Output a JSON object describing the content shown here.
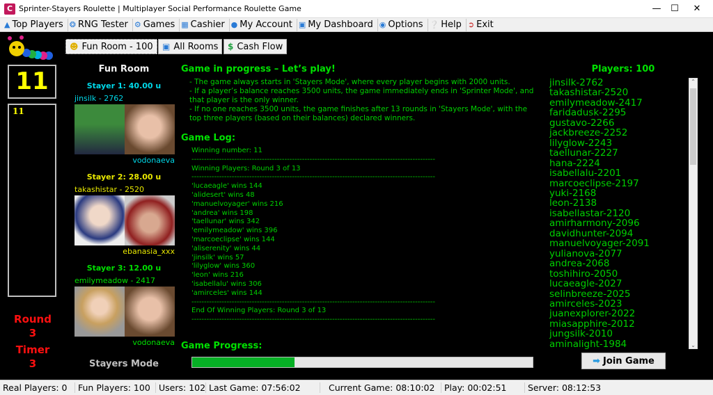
{
  "window": {
    "title": "Sprinter-Stayers Roulette | Multiplayer Social Performance Roulette Game",
    "app_icon": "C"
  },
  "menu": [
    {
      "label": "Top Players",
      "icon": "trophy-icon"
    },
    {
      "label": "RNG Tester",
      "icon": "compass-icon"
    },
    {
      "label": "Games",
      "icon": "gear-icon"
    },
    {
      "label": "Cashier",
      "icon": "calculator-icon"
    },
    {
      "label": "My Account",
      "icon": "user-icon"
    },
    {
      "label": "My Dashboard",
      "icon": "monitor-icon"
    },
    {
      "label": "Options",
      "icon": "options-icon"
    },
    {
      "label": "Help",
      "icon": "help-icon"
    },
    {
      "label": "Exit",
      "icon": "exit-icon"
    }
  ],
  "toolbar": {
    "fun_room": "Fun Room - 100",
    "all_rooms": "All Rooms",
    "cash_flow": "Cash Flow"
  },
  "left": {
    "current_number": "11",
    "history": [
      "11"
    ],
    "round_label": "Round",
    "round": "3",
    "timer_label": "Timer",
    "timer": "3"
  },
  "room": {
    "title": "Fun Room",
    "mode": "Stayers Mode",
    "stayers": [
      {
        "label": "Stayer 1: 40.00 u",
        "player": "jinsilk  -  2762",
        "partner": "vodonaeva",
        "color": "#00d8e8"
      },
      {
        "label": "Stayer 2: 28.00 u",
        "player": "takashistar  -  2520",
        "partner": "ebanasia_xxx",
        "color": "#e8e800"
      },
      {
        "label": "Stayer 3: 12.00 u",
        "player": "emilymeadow  -  2417",
        "partner": "vodonaeva",
        "color": "#00e000"
      }
    ]
  },
  "game": {
    "title": "Game in progress – Let’s play!",
    "rules": [
      "- The game always starts in 'Stayers Mode', where every player begins with 2000 units.",
      "- If a player’s balance reaches 3500 units, the game immediately ends in 'Sprinter Mode', and that player is the only winner.",
      "- If no one reaches 3500 units, the game finishes after 13 rounds in 'Stayers Mode', with the top three players (based on their balances) declared winners."
    ],
    "log_title": "Game Log:",
    "winning_number": "Winning number: 11",
    "winners_header": "Winning Players: Round 3 of 13",
    "winners": [
      "'lucaeagle' wins 144",
      "'alidesert' wins 48",
      "'manuelvoyager' wins 216",
      "'andrea' wins 198",
      "'taellunar' wins 342",
      "'emilymeadow' wins 396",
      "'marcoeclipse' wins 144",
      "'aliserenity' wins 44",
      "'jinsilk' wins 57",
      "'lilyglow' wins 360",
      "'leon' wins 216",
      "'isabellalu' wins 306",
      "'amirceles' wins 144"
    ],
    "winners_footer": "End Of Winning Players: Round 3 of 13",
    "separator": "-------------------------------------------------------------------------------------------------",
    "progress_title": "Game Progress:",
    "progress_percent": 30
  },
  "players": {
    "title": "Players: 100",
    "list": [
      "jinsilk-2762",
      "takashistar-2520",
      "emilymeadow-2417",
      "faridadusk-2295",
      "gustavo-2266",
      "jackbreeze-2252",
      "lilyglow-2243",
      "taellunar-2227",
      "hana-2224",
      "isabellalu-2201",
      "marcoeclipse-2197",
      "yuki-2168",
      "leon-2138",
      "isabellastar-2120",
      "amirharmony-2096",
      "davidhunter-2094",
      "manuelvoyager-2091",
      "yulianova-2077",
      "andrea-2068",
      "toshihiro-2050",
      "lucaeagle-2027",
      "selinbreeze-2025",
      "amirceles-2023",
      "juanexplorer-2022",
      "miasapphire-2012",
      "jungsilk-2010",
      "aminalight-1984"
    ],
    "join": "Join Game"
  },
  "status": [
    "Real Players: 0",
    "Fun Players: 100",
    "Users: 102",
    "Last Game: 07:56:02",
    "Current Game: 08:10:02",
    "Play: 00:02:51",
    "Server: 08:12:53"
  ]
}
